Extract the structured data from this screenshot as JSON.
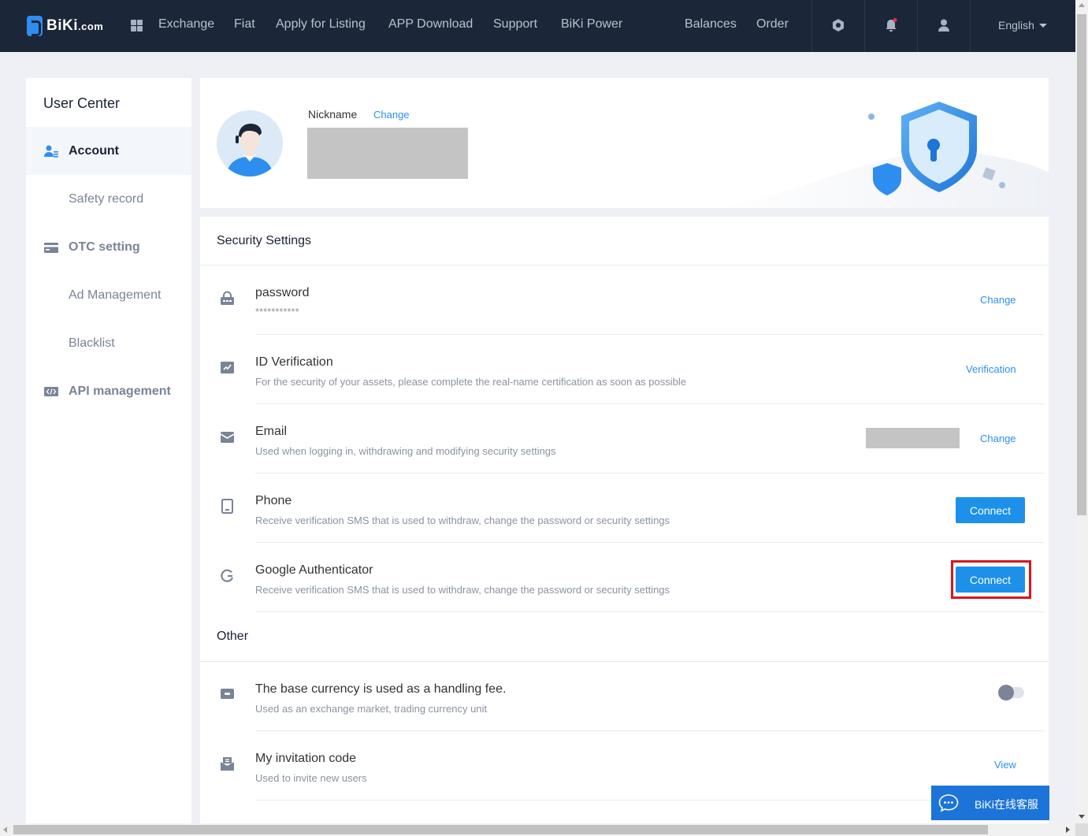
{
  "brand": {
    "logo_text": "BiKi",
    "logo_suffix": ".com"
  },
  "nav": {
    "items": [
      "Exchange",
      "Fiat",
      "Apply for Listing",
      "APP Download",
      "Support",
      "BiKi Power"
    ],
    "right_items": [
      "Balances",
      "Order"
    ],
    "language": "English"
  },
  "sidebar": {
    "title": "User Center",
    "items": [
      {
        "label": "Account",
        "icon": "user-icon"
      },
      {
        "label": "Safety record"
      },
      {
        "label": "OTC setting",
        "icon": "card-icon"
      },
      {
        "label": "Ad Management"
      },
      {
        "label": "Blacklist"
      },
      {
        "label": "API management",
        "icon": "code-icon"
      }
    ]
  },
  "profile": {
    "nickname_label": "Nickname",
    "change_label": "Change"
  },
  "security": {
    "title": "Security Settings",
    "rows": [
      {
        "title": "password",
        "desc": "***********",
        "action": "Change",
        "icon": "lock-icon"
      },
      {
        "title": "ID Verification",
        "desc": "For the security of your assets, please complete the real-name certification as soon as possible",
        "action": "Verification",
        "icon": "id-card-icon"
      },
      {
        "title": "Email",
        "desc": "Used when logging in, withdrawing and modifying security settings",
        "action": "Change",
        "icon": "mail-icon"
      },
      {
        "title": "Phone",
        "desc": "Receive verification SMS that is used to withdraw, change the password or security settings",
        "action": "Connect",
        "icon": "phone-icon"
      },
      {
        "title": "Google Authenticator",
        "desc": "Receive verification SMS that is used to withdraw, change the password or security settings",
        "action": "Connect",
        "icon": "google-icon"
      }
    ]
  },
  "other": {
    "title": "Other",
    "rows": [
      {
        "title": "The base currency is used as a handling fee.",
        "desc": "Used as an exchange market, trading currency unit",
        "toggle_on": false,
        "icon": "wallet-icon"
      },
      {
        "title": "My invitation code",
        "desc": "Used to invite new users",
        "action": "View",
        "icon": "invite-icon"
      }
    ]
  },
  "chat": {
    "label": "BiKi在线客服"
  },
  "colors": {
    "nav_bg": "#1b2638",
    "accent": "#1d90ea",
    "highlight": "#d8161e"
  }
}
